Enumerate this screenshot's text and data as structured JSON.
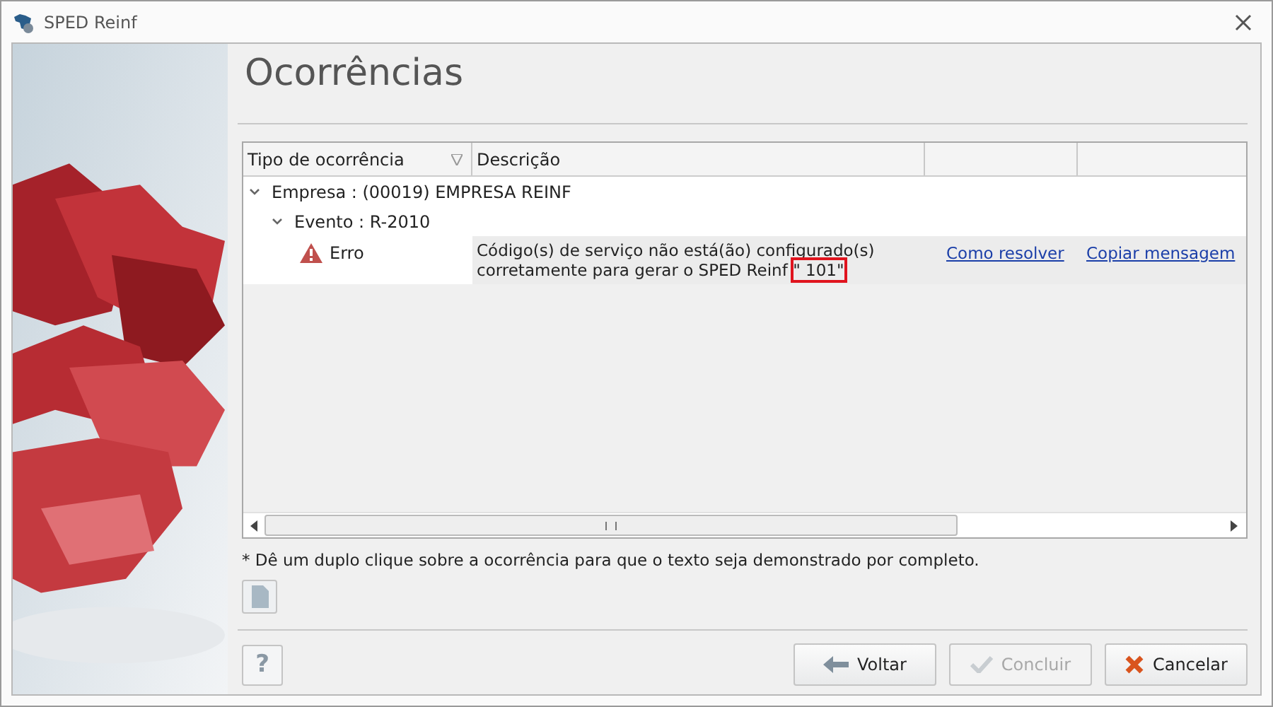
{
  "window": {
    "title": "SPED Reinf"
  },
  "heading": "Ocorrências",
  "table": {
    "columns": [
      {
        "label": "Tipo de ocorrência",
        "filter": true
      },
      {
        "label": "Descrição",
        "filter": false
      },
      {
        "filter": false
      },
      {
        "filter": false
      }
    ],
    "tree": [
      {
        "label": "Empresa : (00019) EMPRESA REINF",
        "expanded": true,
        "children": [
          {
            "label": "Evento : R-2010",
            "expanded": true,
            "children": [
              {
                "type": "Erro",
                "description": "Código(s) de serviço não está(ão) configurado(s) corretamente para gerar o SPED Reinf",
                "highlight": "\" 101\"",
                "links": [
                  "Como resolver",
                  "Copiar mensagem"
                ]
              }
            ]
          }
        ]
      }
    ]
  },
  "note": "* Dê um duplo clique sobre a ocorrência para que o texto seja demonstrado por completo.",
  "help_label": "?",
  "buttons": [
    {
      "kind": "back",
      "label": "Voltar",
      "disabled": false
    },
    {
      "kind": "check",
      "label": "Concluir",
      "disabled": true
    },
    {
      "kind": "cancel",
      "label": "Cancelar",
      "disabled": false
    }
  ]
}
